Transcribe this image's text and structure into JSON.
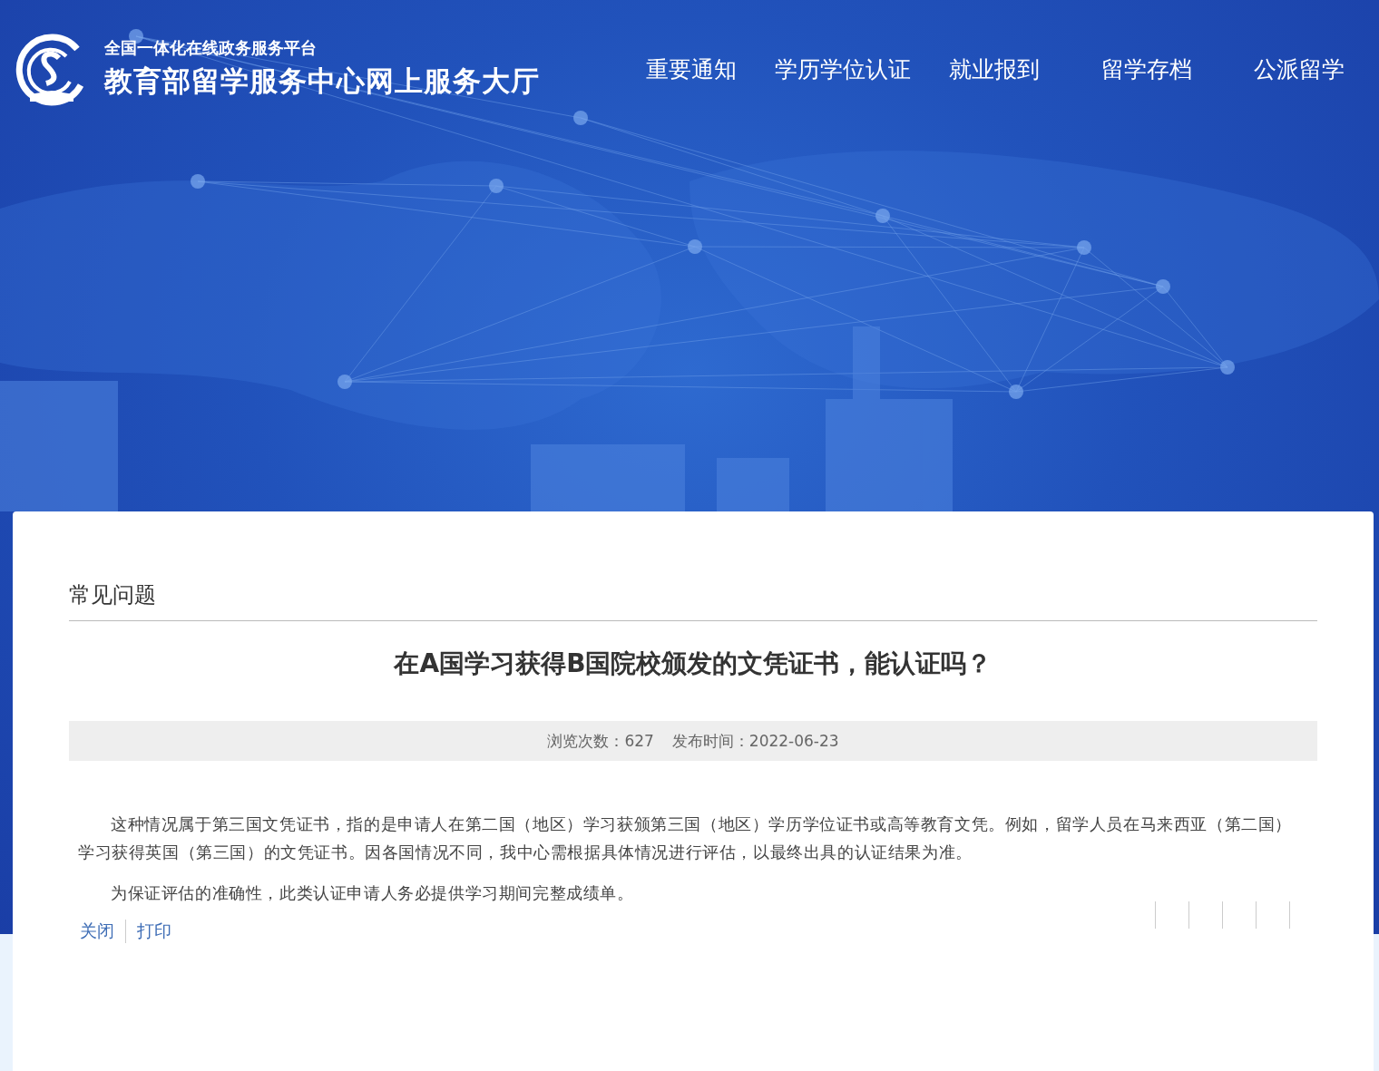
{
  "header": {
    "subtitle": "全国一体化在线政务服务平台",
    "title": "教育部留学服务中心网上服务大厅"
  },
  "nav": [
    {
      "label": "重要通知"
    },
    {
      "label": "学历学位认证"
    },
    {
      "label": "就业报到"
    },
    {
      "label": "留学存档"
    },
    {
      "label": "公派留学"
    }
  ],
  "section_title": "常见问题",
  "article": {
    "title": "在A国学习获得B国院校颁发的文凭证书，能认证吗？",
    "views": "浏览次数：627",
    "published": "发布时间：2022-06-23",
    "paragraphs": [
      "这种情况属于第三国文凭证书，指的是申请人在第二国（地区）学习获颁第三国（地区）学历学位证书或高等教育文凭。例如，留学人员在马来西亚（第二国）学习获得英国（第三国）的文凭证书。因各国情况不同，我中心需根据具体情况进行评估，以最终出具的认证结果为准。",
      "为保证评估的准确性，此类认证申请人务必提供学习期间完整成绩单。"
    ]
  },
  "actions": [
    {
      "label": "关闭"
    },
    {
      "label": "打印"
    }
  ]
}
